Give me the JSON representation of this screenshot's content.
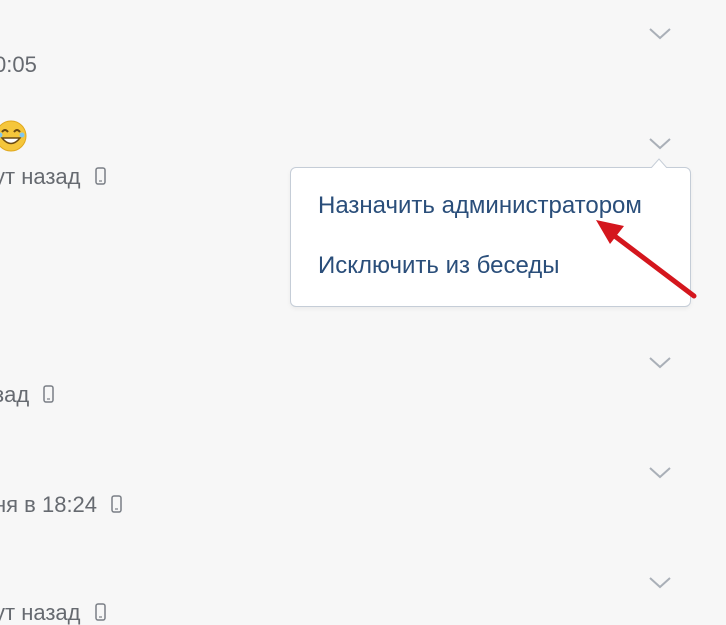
{
  "rows": [
    {
      "status": "0:05"
    },
    {
      "status": "ут назад"
    },
    {
      "status": "зад"
    },
    {
      "status": "ня в 18:24"
    },
    {
      "status": "ут назад"
    }
  ],
  "context_menu": {
    "items": [
      {
        "label": "Назначить администратором"
      },
      {
        "label": "Исключить из беседы"
      }
    ]
  },
  "colors": {
    "menu_text": "#2a4e7a",
    "arrow": "#d4161d",
    "status_text": "#666a70"
  },
  "icons": [
    "chevron-down-icon",
    "phone-icon",
    "emoji-icon",
    "red-arrow-annotation"
  ]
}
